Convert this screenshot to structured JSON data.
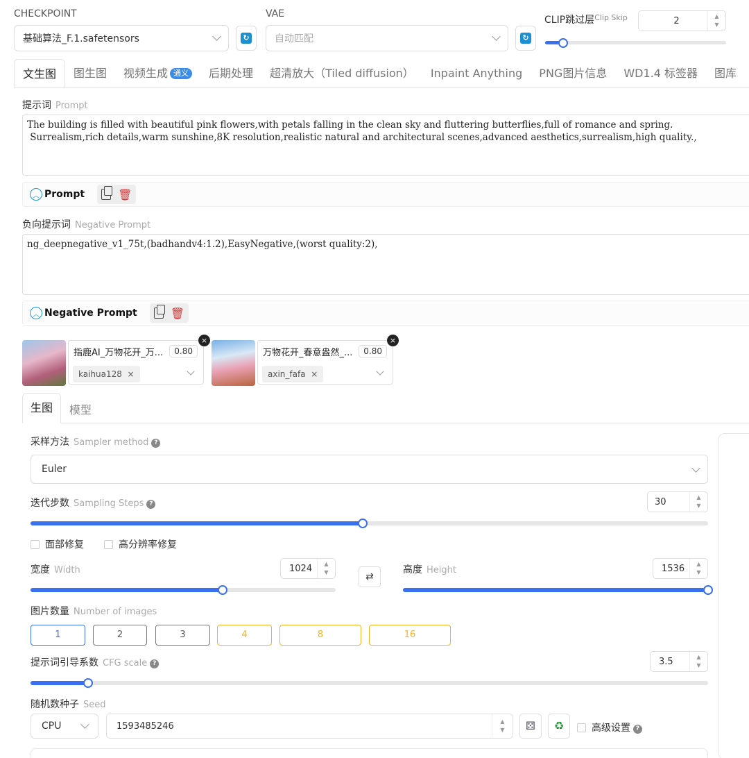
{
  "header": {
    "checkpoint_label": "CHECKPOINT",
    "checkpoint_value": "基础算法_F.1.safetensors",
    "vae_label": "VAE",
    "vae_value": "自动匹配",
    "clip_label": "CLIP跳过层",
    "clip_hint": "Clip Skip",
    "clip_value": "2",
    "clip_slider_fraction": 0.1
  },
  "tabs": [
    {
      "label": "文生图"
    },
    {
      "label": "图生图"
    },
    {
      "label": "视频生成",
      "badge": "通义"
    },
    {
      "label": "后期处理"
    },
    {
      "label": "超清放大（Tiled diffusion）"
    },
    {
      "label": "Inpaint Anything"
    },
    {
      "label": "PNG图片信息"
    },
    {
      "label": "WD1.4 标签器"
    },
    {
      "label": "图库"
    }
  ],
  "prompt": {
    "label": "提示词",
    "hint": "Prompt",
    "text": "The building is filled with beautiful pink flowers,with petals falling in the clean sky and fluttering butterflies,full of romance and spring.\n Surrealism,rich details,warm sunshine,8K resolution,realistic natural and architectural scenes,advanced aesthetics,surrealism,high quality.,",
    "tool_title": "Prompt"
  },
  "negative": {
    "label": "负向提示词",
    "hint": "Negative Prompt",
    "text": "ng_deepnegative_v1_75t,(badhandv4:1.2),EasyNegative,(worst quality:2),",
    "tool_title": "Negative Prompt"
  },
  "loras": [
    {
      "name": "指鹿AI_万物花开_万...",
      "weight": "0.80",
      "tag": "kaihua128",
      "close": "×"
    },
    {
      "name": "万物花开_春意盎然_...",
      "weight": "0.80",
      "tag": "axin_fafa",
      "close": "×"
    }
  ],
  "subtabs": [
    "生图",
    "模型"
  ],
  "sampler": {
    "label": "采样方法",
    "hint": "Sampler method",
    "value": "Euler"
  },
  "steps": {
    "label": "迭代步数",
    "hint": "Sampling Steps",
    "value": "30",
    "fraction": 0.49
  },
  "checks": [
    "面部修复",
    "高分辨率修复"
  ],
  "width": {
    "label": "宽度",
    "hint": "Width",
    "value": "1024",
    "fraction": 0.63
  },
  "height": {
    "label": "高度",
    "hint": "Height",
    "value": "1536",
    "fraction": 1.0
  },
  "swap_icon": "⇄",
  "num_images": {
    "label": "图片数量",
    "hint": "Number of images",
    "options": [
      "1",
      "2",
      "3",
      "4",
      "8",
      "16"
    ],
    "selected": "1"
  },
  "cfg": {
    "label": "提示词引导系数",
    "hint": "CFG scale",
    "value": "3.5",
    "fraction": 0.085
  },
  "seed": {
    "label": "随机数种子",
    "hint": "Seed",
    "device": "CPU",
    "value": "1593485246",
    "advanced": "高级设置"
  },
  "colors": {
    "accent": "#3a6ff0",
    "warn": "#f5b324",
    "refresh": "#1a8fd1",
    "delete": "#dd3333"
  }
}
